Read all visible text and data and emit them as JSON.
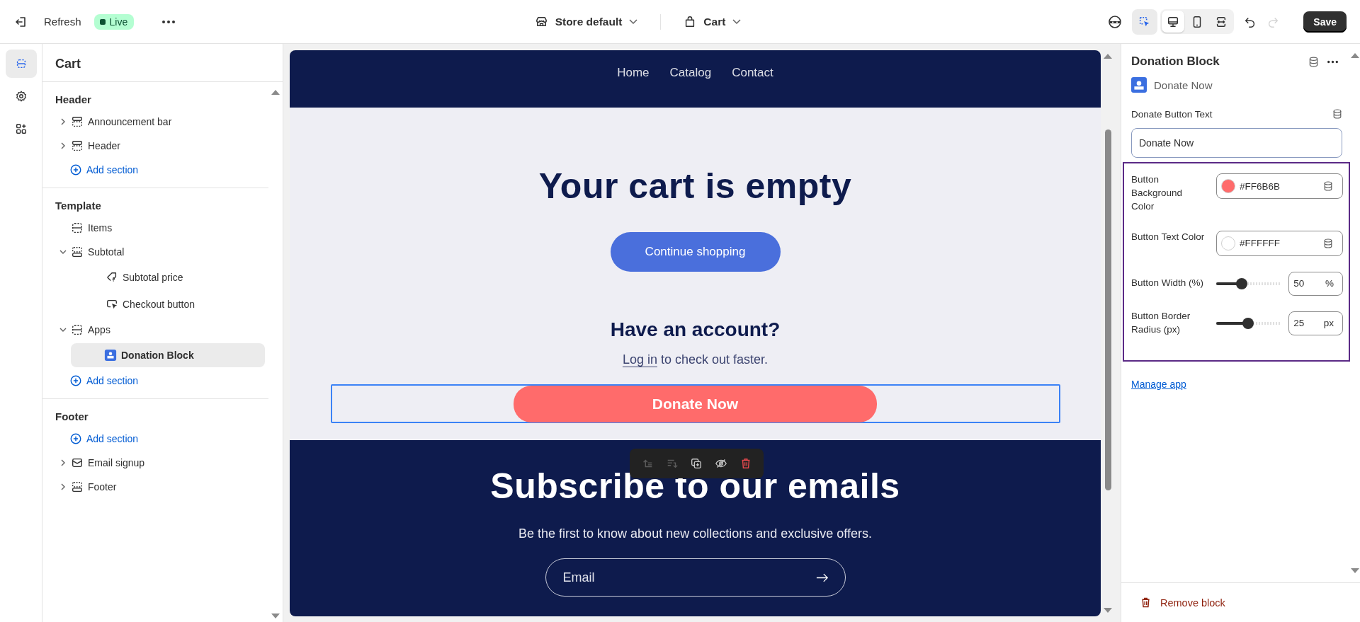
{
  "topbar": {
    "refresh": "Refresh",
    "status": "Live",
    "theme": "Store default",
    "page": "Cart",
    "inspect_mode": {
      "on": true
    },
    "view_modes": [
      {
        "kind": "desktop",
        "selected": true
      },
      {
        "kind": "mobile",
        "selected": false
      },
      {
        "kind": "fullwidth",
        "selected": false
      }
    ],
    "undo": {
      "disabled": false
    },
    "redo": {
      "disabled": true
    },
    "save": "Save"
  },
  "rail": [
    {
      "kind": "sections",
      "selected": true
    },
    {
      "kind": "settings",
      "selected": false
    },
    {
      "kind": "apps",
      "selected": false
    }
  ],
  "sidebar": {
    "title": "Cart",
    "groups": [
      {
        "title": "Header",
        "items": [
          {
            "kind": "header-section",
            "label": "Announcement bar",
            "expanded": false,
            "selected": false
          },
          {
            "kind": "header-section",
            "label": "Header",
            "expanded": false,
            "selected": false
          },
          {
            "kind": "add",
            "label": "Add section"
          }
        ]
      },
      {
        "title": "Template",
        "items": [
          {
            "kind": "section",
            "label": "Items",
            "selected": false
          },
          {
            "kind": "footer-section",
            "label": "Subtotal",
            "expanded": true,
            "selected": false,
            "children": [
              {
                "kind": "price",
                "label": "Subtotal price",
                "selected": false
              },
              {
                "kind": "button",
                "label": "Checkout button",
                "selected": false
              }
            ]
          },
          {
            "kind": "section",
            "label": "Apps",
            "expanded": true,
            "selected": false,
            "children": [
              {
                "kind": "app",
                "label": "Donation Block",
                "selected": true
              }
            ]
          },
          {
            "kind": "add",
            "label": "Add section"
          }
        ]
      },
      {
        "title": "Footer",
        "items": [
          {
            "kind": "add",
            "label": "Add section"
          },
          {
            "kind": "email",
            "label": "Email signup",
            "expanded": false,
            "selected": false
          },
          {
            "kind": "footer-section",
            "label": "Footer",
            "expanded": false,
            "selected": false
          }
        ]
      }
    ]
  },
  "preview": {
    "nav": [
      "Home",
      "Catalog",
      "Contact"
    ],
    "title": "Your cart is empty",
    "continue": "Continue shopping",
    "account_title": "Have an account?",
    "login_link": "Log in",
    "login_rest": "to check out faster.",
    "donate": "Donate Now",
    "subscribe_title": "Subscribe to our emails",
    "subscribe_text": "Be the first to know about new collections and exclusive offers.",
    "email_placeholder": "Email"
  },
  "panel": {
    "title": "Donation Block",
    "app": "Donate Now",
    "settings": [
      {
        "kind": "text",
        "label": "Donate Button Text",
        "value": "Donate Now"
      },
      {
        "kind": "color",
        "label": "Button Background Color",
        "value": "#FF6B6B",
        "color": "#ff6b6b"
      },
      {
        "kind": "color",
        "label": "Button Text Color",
        "value": "#FFFFFF",
        "color": "#ffffff"
      },
      {
        "kind": "range",
        "label": "Button Width (%)",
        "level": 0.4,
        "value": "50",
        "unit": "%"
      },
      {
        "kind": "range",
        "label": "Button Border Radius (px)",
        "level": 0.5,
        "value": "25",
        "unit": "px"
      }
    ],
    "manage": "Manage app",
    "remove": "Remove block"
  }
}
